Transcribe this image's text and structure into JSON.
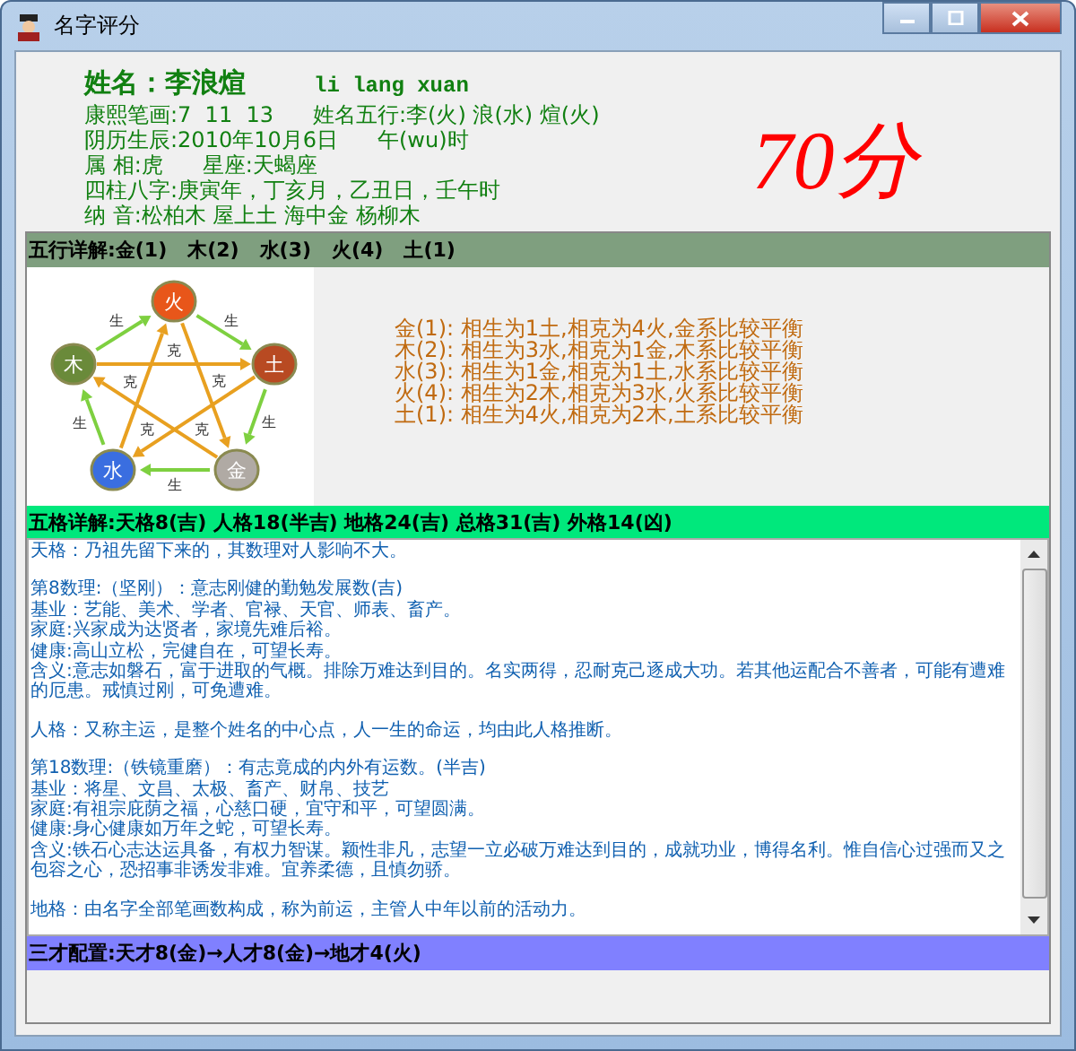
{
  "window": {
    "title": "名字评分"
  },
  "header": {
    "name": "姓名：李浪煊",
    "pinyin": "li lang xuan",
    "rows": [
      {
        "parts": [
          "康熙笔画:7  11  13",
          "姓名五行:李(火) 浪(水) 煊(火)"
        ]
      },
      {
        "parts": [
          "阴历生辰:2010年10月6日",
          "午(wu)时"
        ]
      },
      {
        "parts": [
          "属 相:虎",
          "星座:天蝎座"
        ]
      },
      {
        "parts": [
          "四柱八字:庚寅年，丁亥月，乙丑日，壬午时"
        ]
      },
      {
        "parts": [
          "纳 音:松柏木 屋上土 海中金 杨柳木"
        ]
      }
    ],
    "score": "70分"
  },
  "wuxing": {
    "title": "五行详解:金(1)   木(2)   水(3)   火(4)   土(1)",
    "nodes": [
      {
        "glyph": "火",
        "color": "#e8561a"
      },
      {
        "glyph": "土",
        "color": "#b84a22"
      },
      {
        "glyph": "金",
        "color": "#b0aaa4"
      },
      {
        "glyph": "水",
        "color": "#3a6ee0"
      },
      {
        "glyph": "木",
        "color": "#6a8a3a"
      }
    ],
    "sheng_labels": [
      "生",
      "生",
      "生",
      "生",
      "生"
    ],
    "ke_labels": [
      "克",
      "克",
      "克",
      "克",
      "克"
    ],
    "lines": [
      "金(1): 相生为1土,相克为4火,金系比较平衡",
      "木(2): 相生为3水,相克为1金,木系比较平衡",
      "水(3): 相生为1金,相克为1土,水系比较平衡",
      "火(4): 相生为2木,相克为3水,火系比较平衡",
      "土(1): 相生为4火,相克为2木,土系比较平衡"
    ]
  },
  "wuge": {
    "title": "五格详解:天格8(吉) 人格18(半吉) 地格24(吉) 总格31(吉) 外格14(凶)",
    "blocks": [
      {
        "lines": [
          "天格：乃祖先留下来的，其数理对人影响不大。"
        ]
      },
      {
        "lines": [
          "第8数理:（坚刚）：意志刚健的勤勉发展数(吉)",
          "基业：艺能、美术、学者、官禄、天官、师表、畜产。",
          "家庭:兴家成为达贤者，家境先难后裕。",
          "健康:高山立松，完健自在，可望长寿。",
          "含义:意志如磐石，富于进取的气概。排除万难达到目的。名实两得，忍耐克己逐成大功。若其他运配合不善者，可能有遭难的厄患。戒慎过刚，可免遭难。"
        ]
      },
      {
        "lines": [
          "人格：又称主运，是整个姓名的中心点，人一生的命运，均由此人格推断。"
        ]
      },
      {
        "lines": [
          "第18数理:（铁镜重磨）：有志竟成的内外有运数。(半吉)",
          "基业：将星、文昌、太极、畜产、财帛、技艺",
          "家庭:有祖宗庇荫之福，心慈口硬，宜守和平，可望圆满。",
          "健康:身心健康如万年之蛇，可望长寿。",
          "含义:铁石心志达运具备，有权力智谋。颖性非凡，志望一立必破万难达到目的，成就功业，博得名利。惟自信心过强而又之包容之心，恐招事非诱发非难。宜养柔德，且慎勿骄。"
        ]
      },
      {
        "lines": [
          "地格：由名字全部笔画数构成，称为前运，主管人中年以前的活动力。"
        ]
      }
    ]
  },
  "sancai": {
    "title": "三才配置:天才8(金)→人才8(金)→地才4(火)"
  }
}
